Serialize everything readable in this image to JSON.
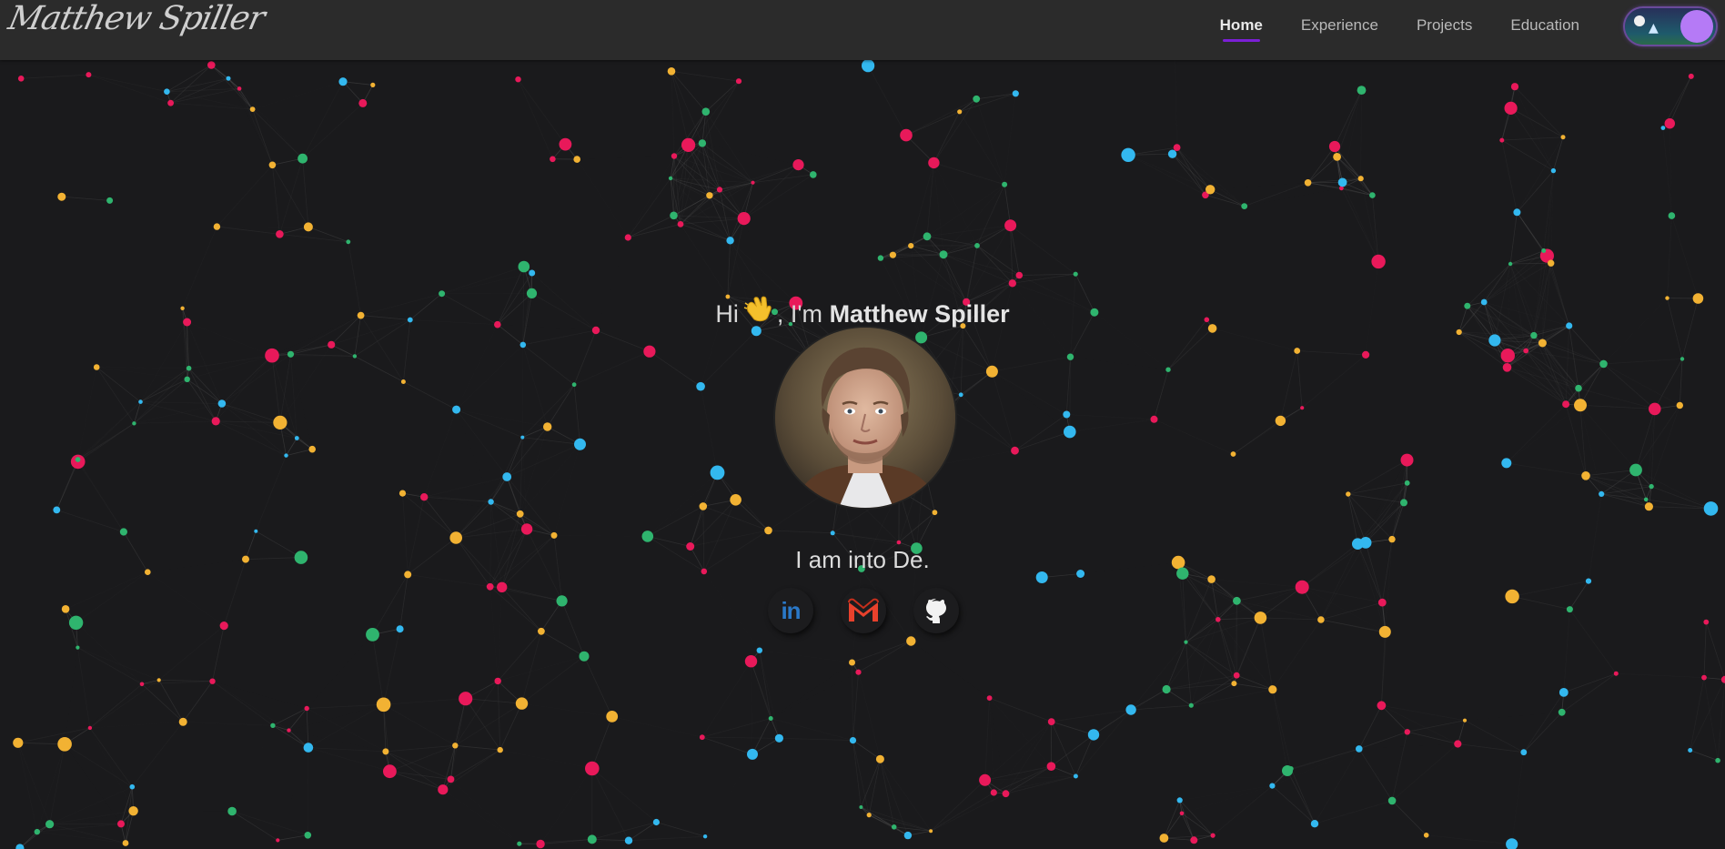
{
  "navbar": {
    "logo_text": "Matthew Spiller",
    "links": [
      {
        "label": "Home",
        "active": true
      },
      {
        "label": "Experience",
        "active": false
      },
      {
        "label": "Projects",
        "active": false
      },
      {
        "label": "Education",
        "active": false
      }
    ],
    "theme_toggle": {
      "state": "dark",
      "knob_color": "#b57af6"
    }
  },
  "hero": {
    "greeting_prefix": "Hi",
    "greeting_wave_icon": "waving-hand-icon",
    "greeting_mid": ", I'm",
    "name": "Matthew Spiller",
    "tagline": "I am into De.",
    "avatar_alt": "profile-photo",
    "socials": [
      {
        "name": "linkedin",
        "icon": "linkedin-icon",
        "color": "#2a78c8"
      },
      {
        "name": "gmail",
        "icon": "gmail-icon",
        "color": "#e8412c"
      },
      {
        "name": "github",
        "icon": "github-icon",
        "color": "#f2f2f2"
      }
    ]
  },
  "colors": {
    "background": "#1a1a1c",
    "navbar": "#2b2b2b",
    "accent": "#7b1fd6",
    "particle_red": "#e8195a",
    "particle_yellow": "#f2b233",
    "particle_green": "#2fb46e",
    "particle_blue": "#33b8ef"
  }
}
